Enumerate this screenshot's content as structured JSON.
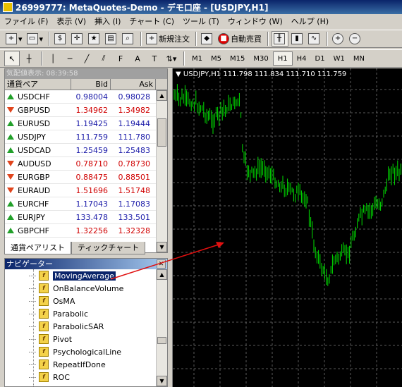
{
  "window": {
    "title": "26999777: MetaQuotes-Demo - デモ口座 - [USDJPY,H1]"
  },
  "menu": [
    "ファイル (F)",
    "表示 (V)",
    "挿入 (I)",
    "チャート (C)",
    "ツール (T)",
    "ウィンドウ (W)",
    "ヘルプ (H)"
  ],
  "toolbar": {
    "new_order": "新規注文",
    "auto_trade": "自動売買"
  },
  "timeframes": [
    "M1",
    "M5",
    "M15",
    "M30",
    "H1",
    "H4",
    "D1",
    "W1",
    "MN"
  ],
  "timeframe_active": "H1",
  "market_watch": {
    "title": "気配値表示: 08:39:58",
    "headers": {
      "symbol": "通貨ペア",
      "bid": "Bid",
      "ask": "Ask"
    },
    "rows": [
      {
        "symbol": "USDCHF",
        "bid": "0.98004",
        "ask": "0.98028",
        "dir": "up",
        "color": "#1a1aa8"
      },
      {
        "symbol": "GBPUSD",
        "bid": "1.34962",
        "ask": "1.34982",
        "dir": "down",
        "color": "#d00000"
      },
      {
        "symbol": "EURUSD",
        "bid": "1.19425",
        "ask": "1.19444",
        "dir": "up",
        "color": "#1a1aa8"
      },
      {
        "symbol": "USDJPY",
        "bid": "111.759",
        "ask": "111.780",
        "dir": "up",
        "color": "#1a1aa8"
      },
      {
        "symbol": "USDCAD",
        "bid": "1.25459",
        "ask": "1.25483",
        "dir": "up",
        "color": "#1a1aa8"
      },
      {
        "symbol": "AUDUSD",
        "bid": "0.78710",
        "ask": "0.78730",
        "dir": "down",
        "color": "#d00000"
      },
      {
        "symbol": "EURGBP",
        "bid": "0.88475",
        "ask": "0.88501",
        "dir": "down",
        "color": "#d00000"
      },
      {
        "symbol": "EURAUD",
        "bid": "1.51696",
        "ask": "1.51748",
        "dir": "down",
        "color": "#d00000"
      },
      {
        "symbol": "EURCHF",
        "bid": "1.17043",
        "ask": "1.17083",
        "dir": "up",
        "color": "#1a1aa8"
      },
      {
        "symbol": "EURJPY",
        "bid": "133.478",
        "ask": "133.501",
        "dir": "up",
        "color": "#1a1aa8"
      },
      {
        "symbol": "GBPCHF",
        "bid": "1.32256",
        "ask": "1.32328",
        "dir": "up",
        "color": "#d00000"
      }
    ],
    "tabs": [
      "通貨ペアリスト",
      "ティックチャート"
    ]
  },
  "navigator": {
    "title": "ナビゲーター",
    "items": [
      "MovingAverage",
      "OnBalanceVolume",
      "OsMA",
      "Parabolic",
      "ParabolicSAR",
      "Pivot",
      "PsychologicalLine",
      "RepeatIfDone",
      "ROC"
    ],
    "selected": "MovingAverage"
  },
  "chart": {
    "header": "USDJPY,H1  111.798 111.834 111.710 111.759"
  }
}
